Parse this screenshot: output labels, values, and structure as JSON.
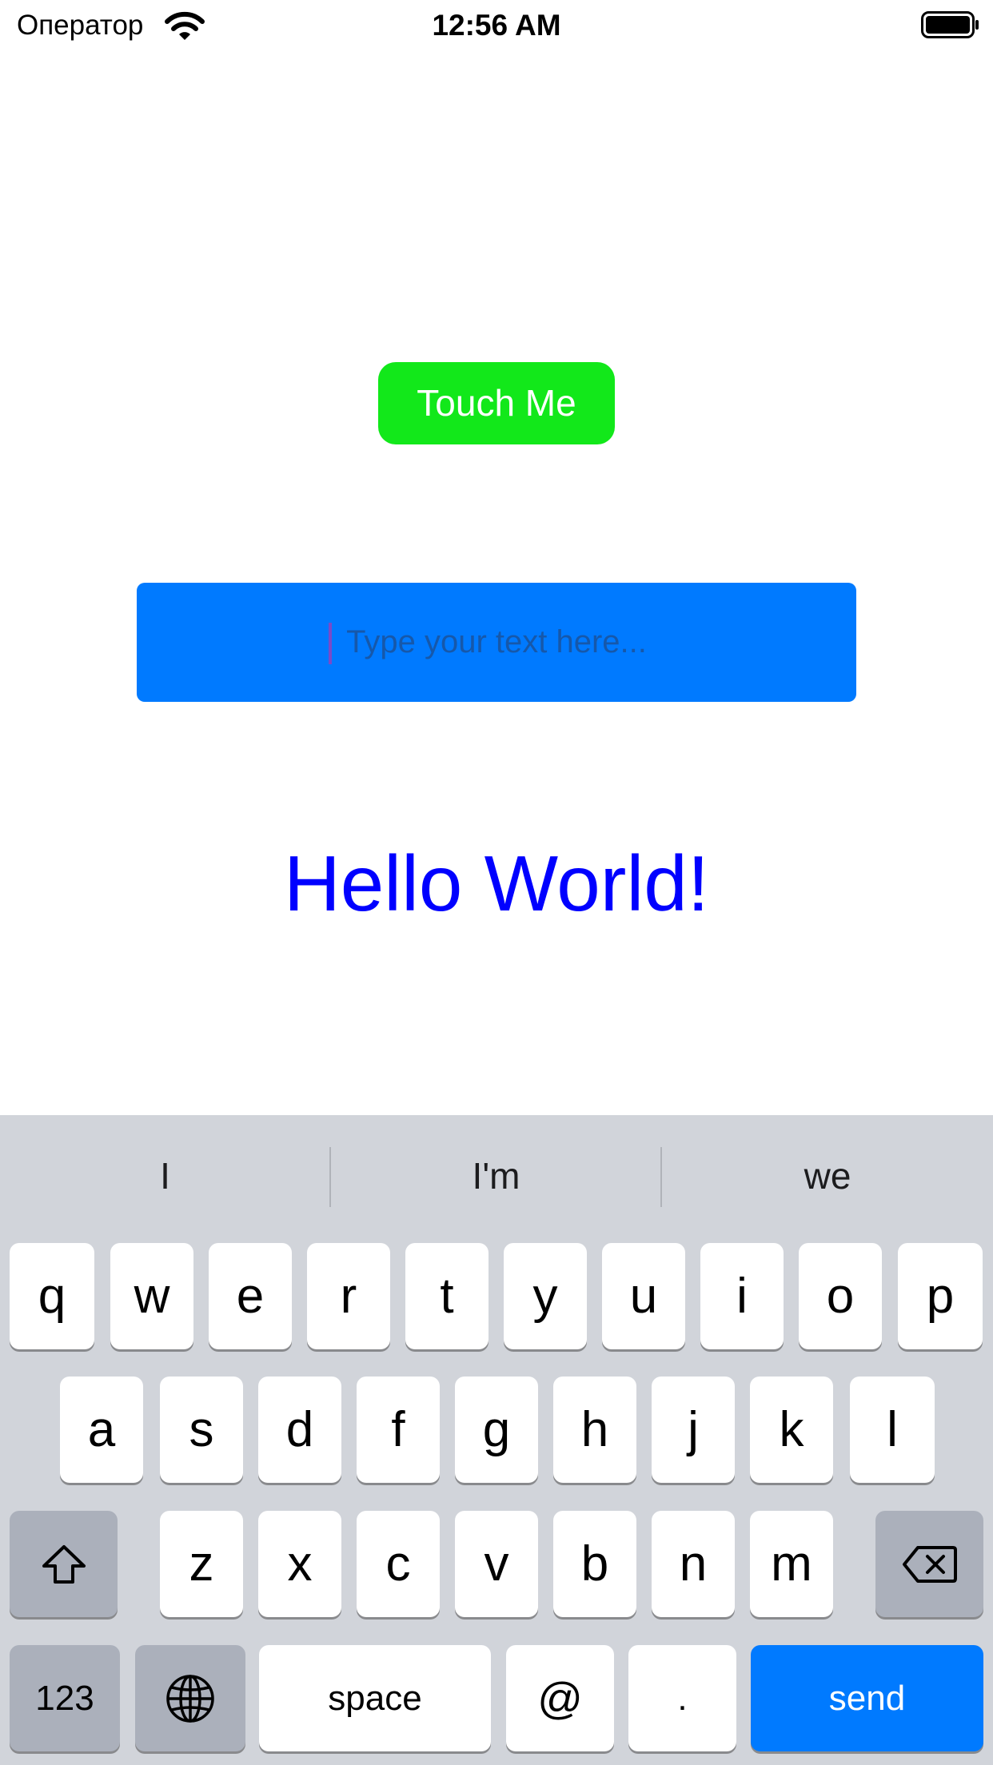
{
  "status_bar": {
    "carrier": "Оператор",
    "time": "12:56 AM"
  },
  "main": {
    "button_label": "Touch Me",
    "text_field": {
      "value": "",
      "placeholder": "Type your text here..."
    },
    "label": "Hello World!"
  },
  "colors": {
    "button_bg": "#12e81a",
    "field_bg": "#007aff",
    "label_color": "#0000ff",
    "send_key": "#007aff"
  },
  "keyboard": {
    "suggestions": [
      "I",
      "I'm",
      "we"
    ],
    "row1": [
      "q",
      "w",
      "e",
      "r",
      "t",
      "y",
      "u",
      "i",
      "o",
      "p"
    ],
    "row2": [
      "a",
      "s",
      "d",
      "f",
      "g",
      "h",
      "j",
      "k",
      "l"
    ],
    "row3": [
      "z",
      "x",
      "c",
      "v",
      "b",
      "n",
      "m"
    ],
    "numbers_key": "123",
    "space_key": "space",
    "at_key": "@",
    "period_key": ".",
    "send_key": "send"
  },
  "icons": [
    "wifi-icon",
    "battery-icon",
    "shift-icon",
    "delete-icon",
    "globe-icon"
  ]
}
